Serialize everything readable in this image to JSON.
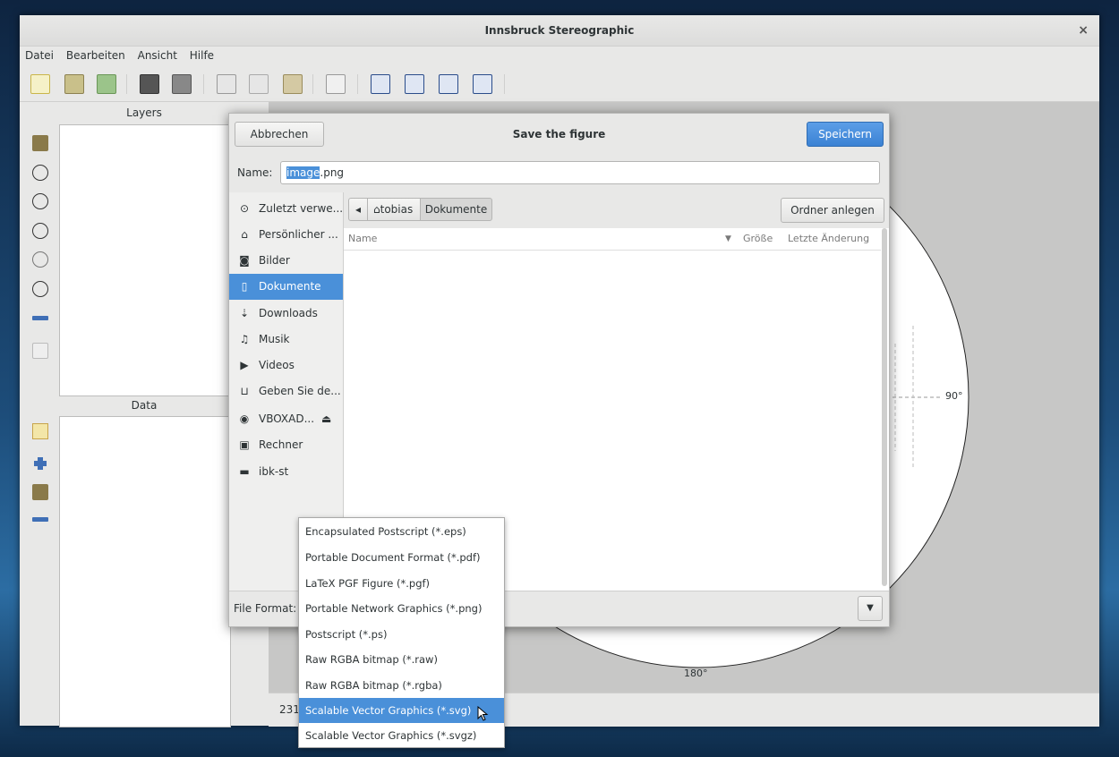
{
  "window": {
    "title": "Innsbruck Stereographic",
    "close": "×"
  },
  "menu": [
    "Datei",
    "Bearbeiten",
    "Ansicht",
    "Hilfe"
  ],
  "panels": {
    "layers_title": "Layers",
    "data_title": "Data"
  },
  "plot": {
    "label_90": "90°",
    "label_180": "180°",
    "status_prefix": "231"
  },
  "dialog": {
    "cancel_label": "Abbrechen",
    "title": "Save the figure",
    "save_label": "Speichern",
    "name_label": "Name:",
    "filename_selected": "image",
    "filename_rest": ".png",
    "places": [
      {
        "icon": "⊙",
        "label": "Zuletzt verwe..."
      },
      {
        "icon": "⌂",
        "label": "Persönlicher ..."
      },
      {
        "icon": "◙",
        "label": "Bilder"
      },
      {
        "icon": "▯",
        "label": "Dokumente"
      },
      {
        "icon": "⇣",
        "label": "Downloads"
      },
      {
        "icon": "♫",
        "label": "Musik"
      },
      {
        "icon": "▶",
        "label": "Videos"
      },
      {
        "icon": "⊔",
        "label": "Geben Sie de..."
      },
      {
        "icon": "◉",
        "label": "VBOXAD...",
        "eject": "⏏"
      },
      {
        "icon": "▣",
        "label": "Rechner"
      },
      {
        "icon": "▬",
        "label": "ibk-st"
      }
    ],
    "breadcrumbs": [
      "tobias",
      "Dokumente"
    ],
    "back_arrow": "◂",
    "new_folder_label": "Ordner anlegen",
    "columns": [
      "Name",
      "Größe",
      "Letzte Änderung"
    ],
    "file_format_label": "File Format:"
  },
  "format_options": [
    "Encapsulated Postscript (*.eps)",
    "Portable Document Format (*.pdf)",
    "LaTeX PGF Figure (*.pgf)",
    "Portable Network Graphics (*.png)",
    "Postscript (*.ps)",
    "Raw RGBA bitmap (*.raw)",
    "Raw RGBA bitmap (*.rgba)",
    "Scalable Vector Graphics (*.svg)",
    "Scalable Vector Graphics (*.svgz)"
  ],
  "selected_format_index": 7
}
